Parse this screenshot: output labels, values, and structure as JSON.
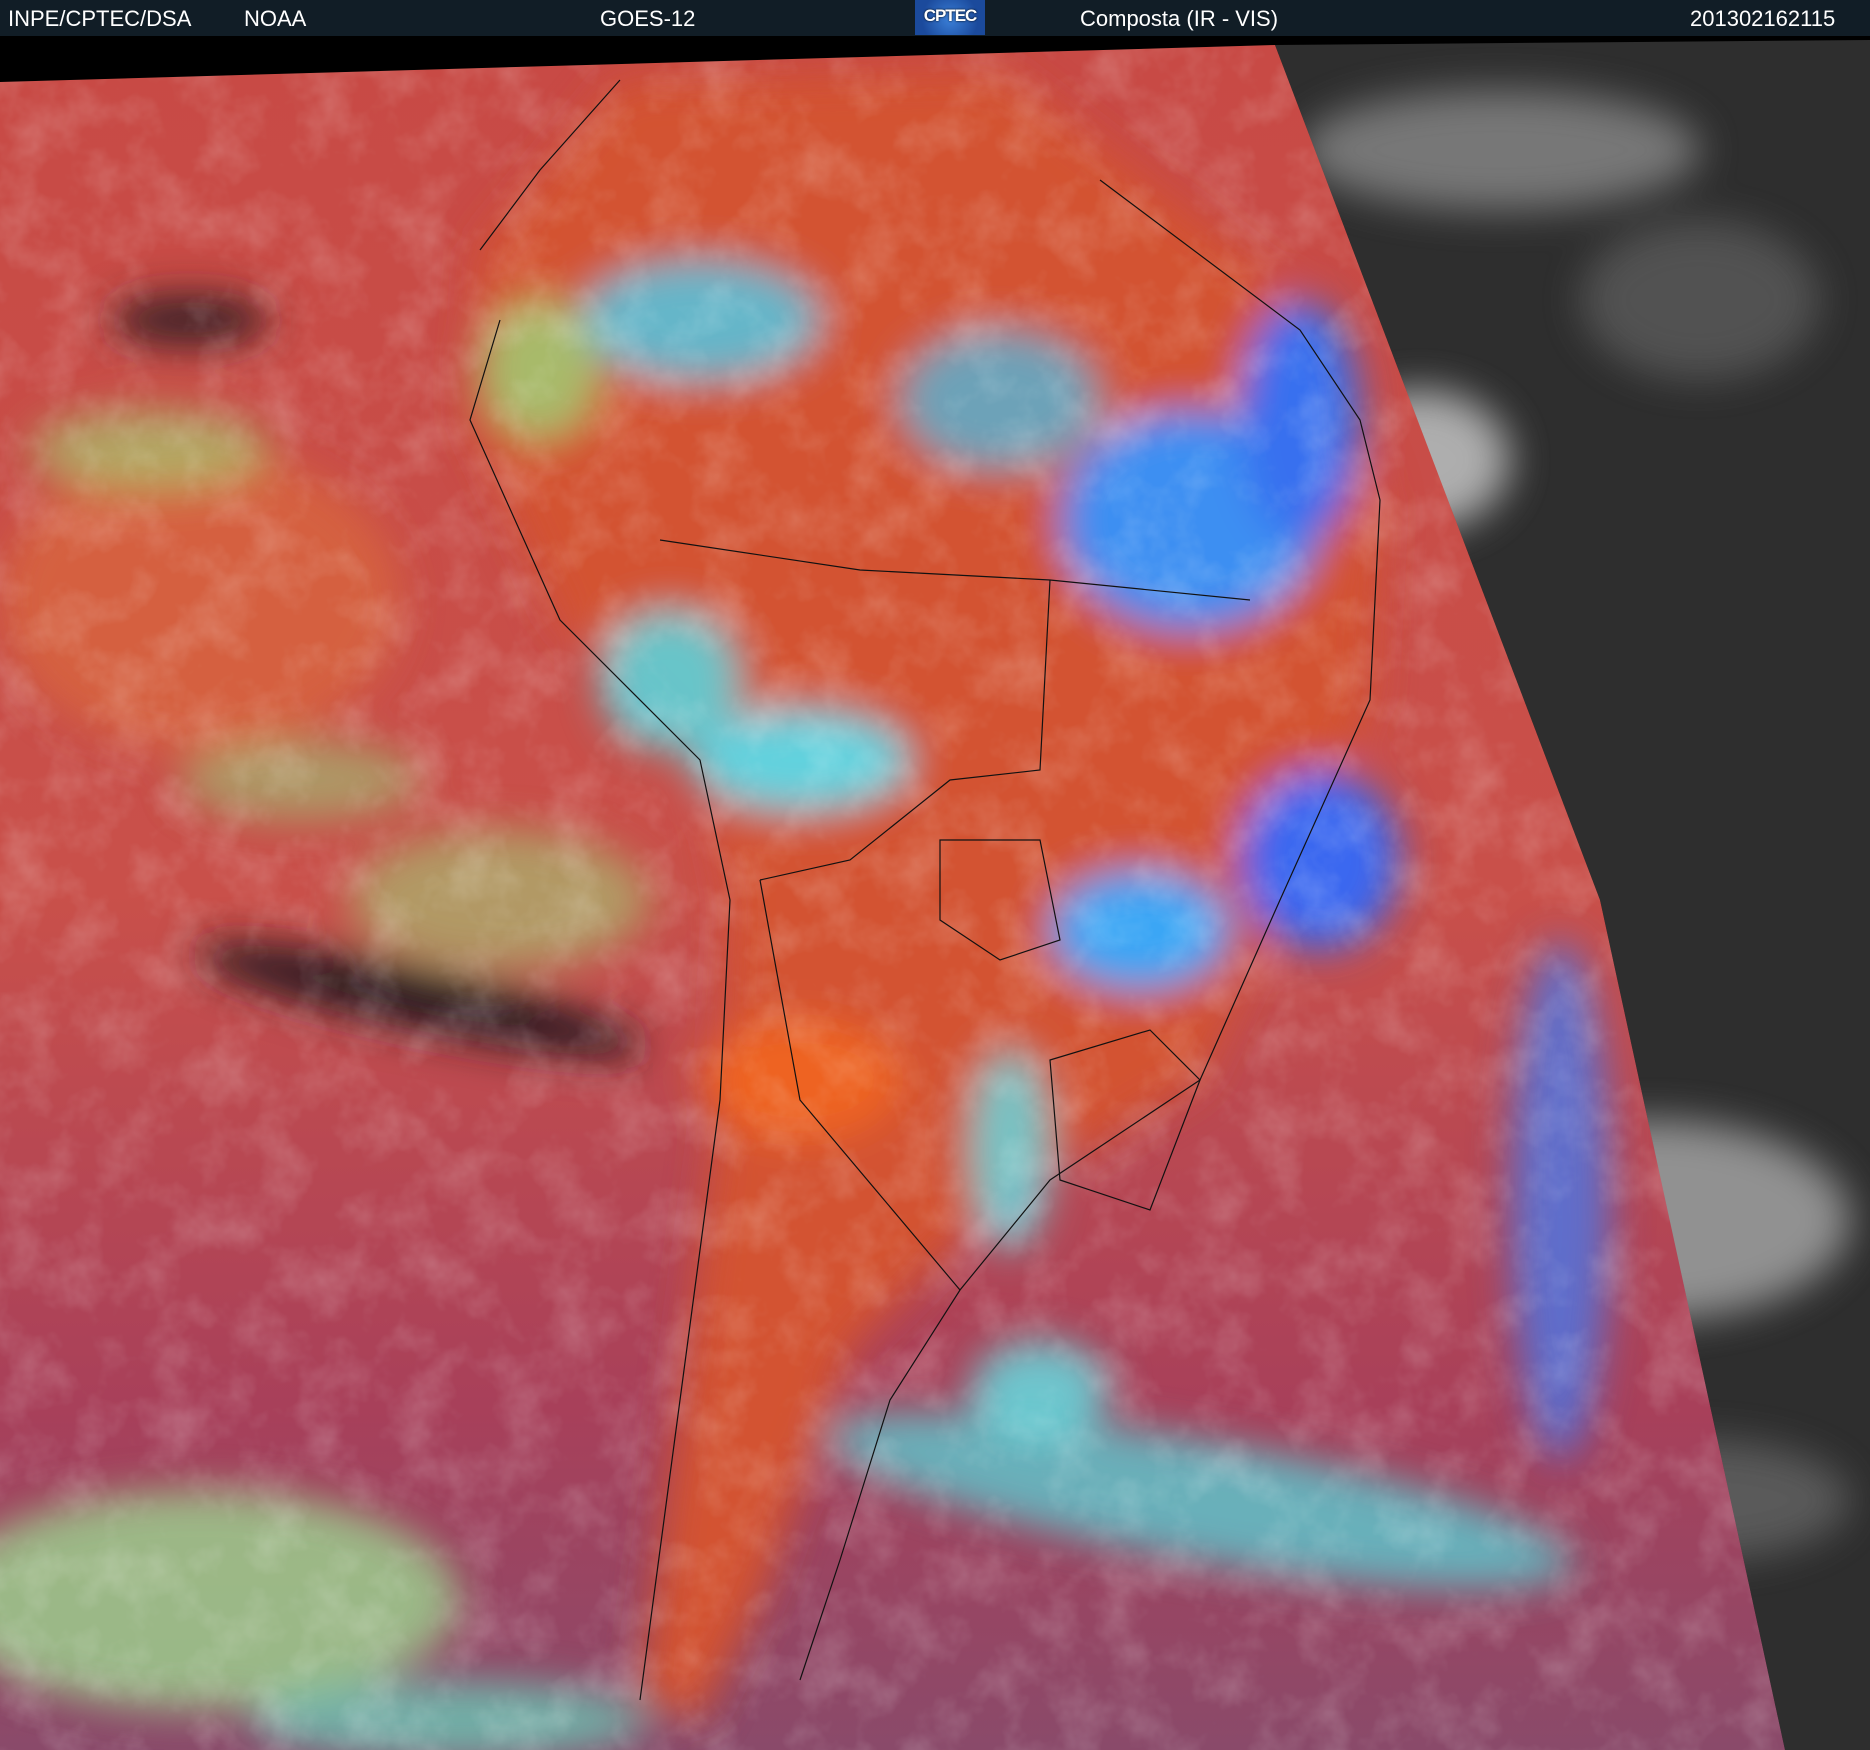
{
  "header": {
    "institution": "INPE/CPTEC/DSA",
    "agency": "NOAA",
    "satellite": "GOES-12",
    "logo_text": "CPTEC",
    "product": "Composta (IR - VIS)",
    "timestamp": "201302162115"
  },
  "colors": {
    "header_bg": "#111d26",
    "ocean_ir": "#b8434f",
    "land_ir": "#d5512f",
    "cloud_cyan": "#3fd4f0",
    "cloud_blue": "#3a6ef0",
    "vis_gray": "#3a3a3a"
  }
}
